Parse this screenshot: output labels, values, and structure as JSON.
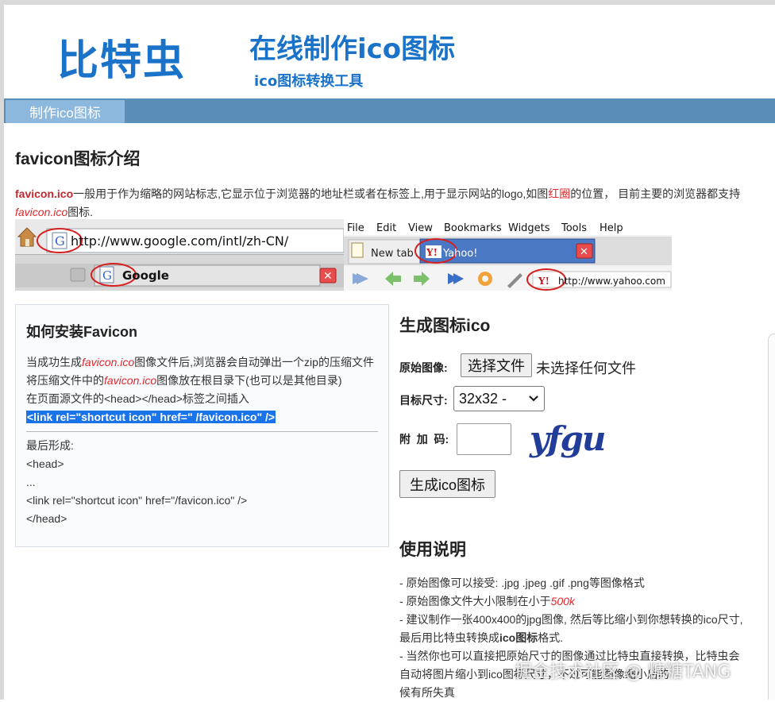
{
  "header": {
    "brand": "比特虫",
    "slogan": "在线制作ico图标",
    "slogan_sub": "ico图标转换工具"
  },
  "nav": {
    "tab_make": "制作ico图标"
  },
  "intro": {
    "title": "favicon图标介绍",
    "p1_name": "favicon.ico",
    "p1_a": "一般用于作为缩略的网站标志,它显示位于浏览器的地址栏或者在标签上,用于显示网站的logo,如图",
    "p1_red": "红圈",
    "p1_b": "的位置， 目前主要的浏览器都支持",
    "p1_file": "favicon.ico",
    "p1_end": "图标."
  },
  "collage": {
    "google_url": "http://www.google.com/intl/zh-CN/",
    "google_tab": "Google",
    "menu": [
      "File",
      "Edit",
      "View",
      "Bookmarks",
      "Widgets",
      "Tools",
      "Help"
    ],
    "new_tab": "New tab",
    "yahoo_tab": "Yahoo!",
    "yahoo_url": "http://www.yahoo.com"
  },
  "install": {
    "title": "如何安装Favicon",
    "l1_a": "当成功生成",
    "l1_file": "favicon.ico",
    "l1_b": "图像文件后,浏览器会自动弹出一个zip的压缩文件",
    "l2_a": "将压缩文件中的",
    "l2_file": "favicon.ico",
    "l2_b": "图像放在根目录下(也可以是其他目录)",
    "l3": "在页面源文件的<head></head>标签之间插入",
    "code": "<link rel=\"shortcut icon\" href=\" /favicon.ico\" />",
    "final_label": "最后形成:",
    "final_1": "<head>",
    "final_2": "...",
    "final_3": "<link rel=\"shortcut icon\" href=\"/favicon.ico\" />",
    "final_4": "</head>"
  },
  "generator": {
    "title": "生成图标ico",
    "label_image": "原始图像:",
    "file_button": "选择文件",
    "file_status": "未选择任何文件",
    "label_size": "目标尺寸:",
    "size_value": "32x32 -",
    "label_code": "附  加  码:",
    "captcha": "yfgu",
    "submit": "生成ico图标"
  },
  "usage": {
    "title": "使用说明",
    "i1": "- 原始图像可以接受: .jpg .jpeg .gif .png等图像格式",
    "i2_a": "- 原始图像文件大小限制在小于",
    "i2_red": "500k",
    "i3_a": "- 建议制作一张400x400的jpg图像, 然后等比缩小到你想转换的ico尺寸,最后用比特虫转换成",
    "i3_bold": "ico图标",
    "i3_b": "格式.",
    "i4": "- 当然你也可以直接把原始尺寸的图像通过比特虫直接转换，比特虫会自动将图片缩小到ico图标尺寸，不过可能图像缩小后的",
    "i4_end": "候有所失真"
  },
  "watermark": "掘金技术社区 @ 糖糖TANG",
  "colors": {
    "brand_blue": "#1a73c9",
    "nav_bar": "#5a8db8",
    "nav_tab": "#8db8de",
    "highlight": "#1a73e8",
    "accent_red": "#e0282d"
  }
}
